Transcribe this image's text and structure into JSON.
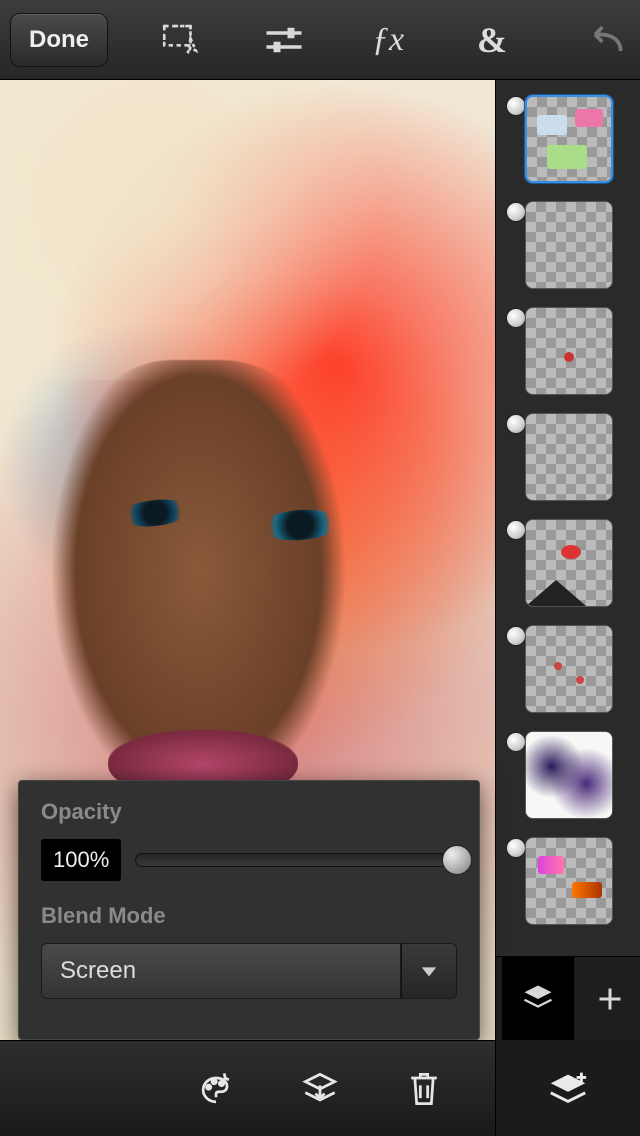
{
  "toolbar": {
    "done_label": "Done"
  },
  "panel": {
    "opacity_label": "Opacity",
    "opacity_value": "100%",
    "blend_label": "Blend Mode",
    "blend_value": "Screen"
  },
  "layers": {
    "count": 8,
    "selected_index": 0
  }
}
